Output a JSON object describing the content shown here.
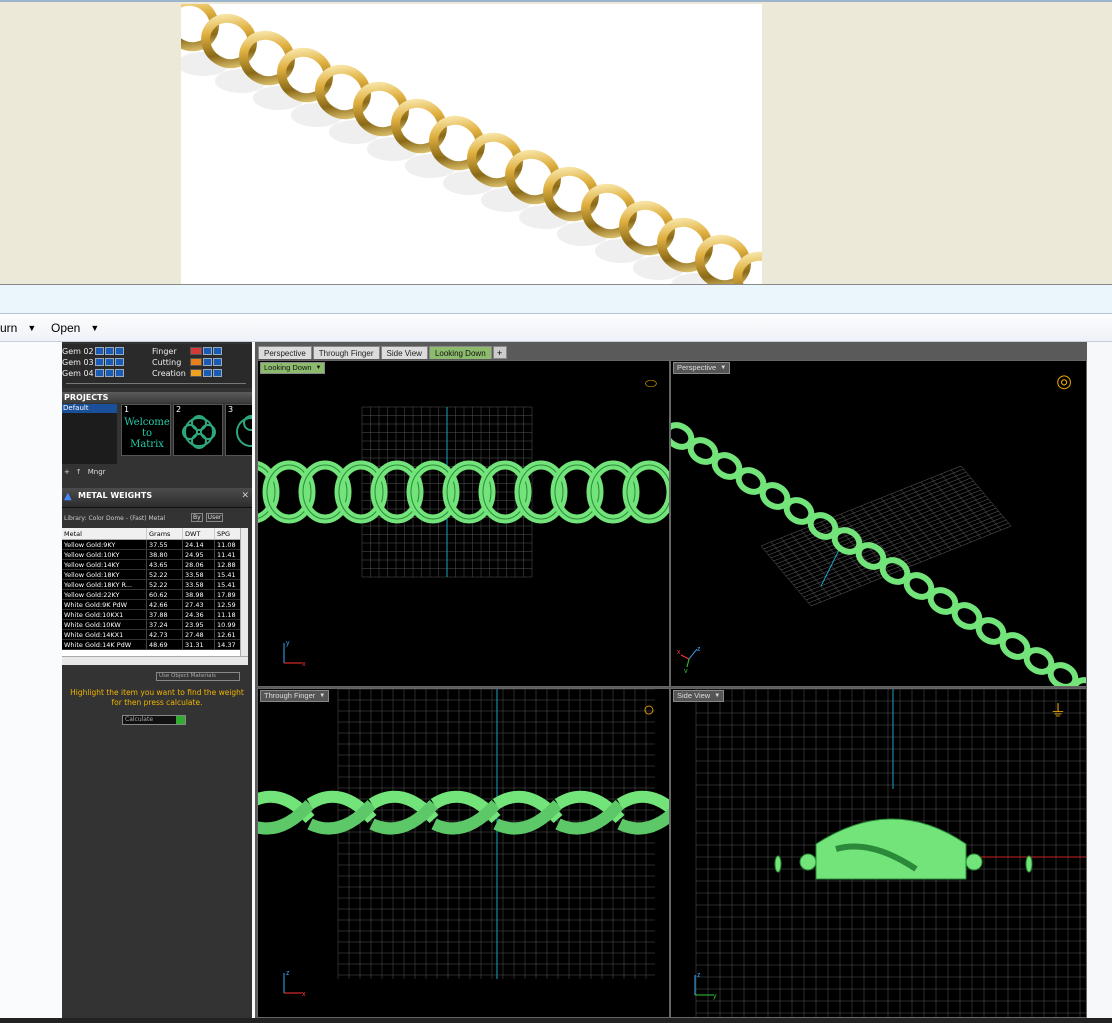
{
  "menubar": {
    "items": [
      {
        "label": "urn"
      },
      {
        "label": "Open"
      }
    ]
  },
  "layers": [
    {
      "name": "Gem 02",
      "right": "Finger",
      "color": "#d23b3b"
    },
    {
      "name": "Gem 03",
      "right": "Cutting",
      "color": "#e8801a"
    },
    {
      "name": "Gem 04",
      "right": "Creation",
      "color": "#f0a020"
    }
  ],
  "projects": {
    "title": "PROJECTS",
    "list": [
      "Default"
    ],
    "thumbs": [
      {
        "num": "1",
        "text": "Welcome to Matrix"
      },
      {
        "num": "2",
        "text": ""
      },
      {
        "num": "3",
        "text": ""
      }
    ],
    "mngr_label": "Mngr"
  },
  "metal_weights": {
    "title": "METAL WEIGHTS",
    "library": "Library: Color Dome - (Fast) Metal",
    "by_label": "By",
    "user_label": "User",
    "columns": [
      "Metal",
      "Grams",
      "DWT",
      "SPG"
    ],
    "rows": [
      [
        "Yellow Gold:9KY",
        "37.55",
        "24.14",
        "11.08"
      ],
      [
        "Yellow Gold:10KY",
        "38.80",
        "24.95",
        "11.41"
      ],
      [
        "Yellow Gold:14KY",
        "43.65",
        "28.06",
        "12.88"
      ],
      [
        "Yellow Gold:18KY",
        "52.22",
        "33.58",
        "15.41"
      ],
      [
        "Yellow Gold:18KY R...",
        "52.22",
        "33.58",
        "15.41"
      ],
      [
        "Yellow Gold:22KY",
        "60.62",
        "38.98",
        "17.89"
      ],
      [
        "White Gold:9K PdW",
        "42.66",
        "27.43",
        "12.59"
      ],
      [
        "White Gold:10KX1",
        "37.88",
        "24.36",
        "11.18"
      ],
      [
        "White Gold:10KW",
        "37.24",
        "23.95",
        "10.99"
      ],
      [
        "White Gold:14KX1",
        "42.73",
        "27.48",
        "12.61"
      ],
      [
        "White Gold:14K PdW",
        "48.69",
        "31.31",
        "14.37"
      ]
    ],
    "use_object_materials": "Use Object Materials",
    "hint": "Highlight the item you want to find the weight for then press calculate.",
    "calculate": "Calculate"
  },
  "viewport_tabs": [
    "Perspective",
    "Through Finger",
    "Side View",
    "Looking Down"
  ],
  "active_tab": "Looking Down",
  "viewports": {
    "tl": {
      "label": "Looking Down"
    },
    "tr": {
      "label": "Perspective"
    },
    "bl": {
      "label": "Through Finger"
    },
    "br": {
      "label": "Side View"
    }
  },
  "colors": {
    "model": "#72e47a",
    "active_tab": "#8dbb6d",
    "gold": "#e0b040",
    "hint": "#f0b400"
  }
}
